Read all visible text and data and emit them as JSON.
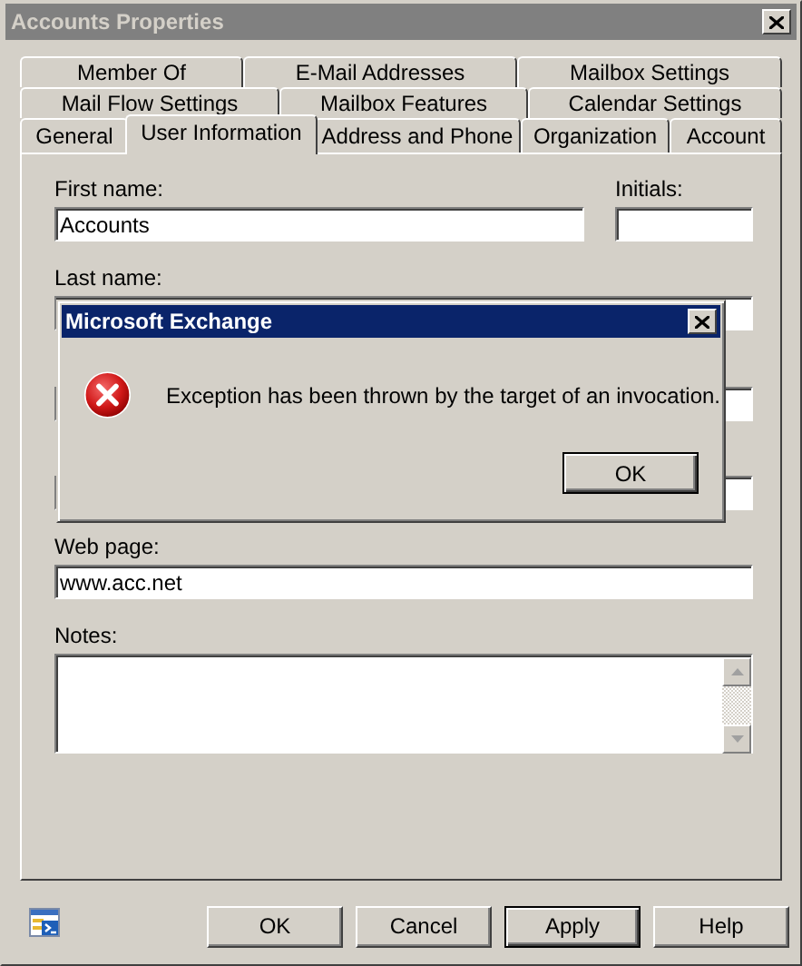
{
  "window": {
    "title": "Accounts Properties"
  },
  "tab_rows": [
    [
      {
        "label": "Member Of",
        "selected": false
      },
      {
        "label": "E-Mail Addresses",
        "selected": false
      },
      {
        "label": "Mailbox Settings",
        "selected": false
      }
    ],
    [
      {
        "label": "Mail Flow Settings",
        "selected": false
      },
      {
        "label": "Mailbox Features",
        "selected": false
      },
      {
        "label": "Calendar Settings",
        "selected": false
      }
    ],
    [
      {
        "label": "General",
        "selected": false
      },
      {
        "label": "User Information",
        "selected": true
      },
      {
        "label": "Address and Phone",
        "selected": false
      },
      {
        "label": "Organization",
        "selected": false
      },
      {
        "label": "Account",
        "selected": false
      }
    ]
  ],
  "fields": {
    "first_name": {
      "label": "First name:",
      "value": "Accounts"
    },
    "initials": {
      "label": "Initials:"
    },
    "last_name": {
      "label": "Last name:"
    },
    "web_page": {
      "label": "Web page:",
      "value": "www.acc.net"
    },
    "notes": {
      "label": "Notes:"
    }
  },
  "dialog": {
    "title": "Microsoft Exchange",
    "message": "Exception has been thrown by the target of an invocation.",
    "button": "OK"
  },
  "buttons": [
    {
      "label": "OK",
      "default": false
    },
    {
      "label": "Cancel",
      "default": false
    },
    {
      "label": "Apply",
      "default": true
    },
    {
      "label": "Help",
      "default": false
    }
  ]
}
